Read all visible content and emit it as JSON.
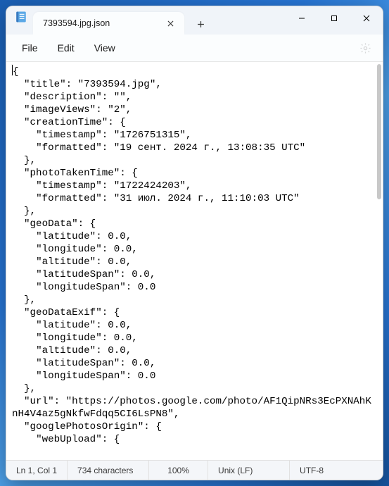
{
  "tab": {
    "title": "7393594.jpg.json"
  },
  "menu": {
    "file": "File",
    "edit": "Edit",
    "view": "View"
  },
  "editor": {
    "text": "{\n  \"title\": \"7393594.jpg\",\n  \"description\": \"\",\n  \"imageViews\": \"2\",\n  \"creationTime\": {\n    \"timestamp\": \"1726751315\",\n    \"formatted\": \"19 сент. 2024 г., 13:08:35 UTC\"\n  },\n  \"photoTakenTime\": {\n    \"timestamp\": \"1722424203\",\n    \"formatted\": \"31 июл. 2024 г., 11:10:03 UTC\"\n  },\n  \"geoData\": {\n    \"latitude\": 0.0,\n    \"longitude\": 0.0,\n    \"altitude\": 0.0,\n    \"latitudeSpan\": 0.0,\n    \"longitudeSpan\": 0.0\n  },\n  \"geoDataExif\": {\n    \"latitude\": 0.0,\n    \"longitude\": 0.0,\n    \"altitude\": 0.0,\n    \"latitudeSpan\": 0.0,\n    \"longitudeSpan\": 0.0\n  },\n  \"url\": \"https://photos.google.com/photo/AF1QipNRs3EcPXNAhKnH4V4az5gNkfwFdqq5CI6LsPN8\",\n  \"googlePhotosOrigin\": {\n    \"webUpload\": {"
  },
  "status": {
    "position": "Ln 1, Col 1",
    "characters": "734 characters",
    "zoom": "100%",
    "line_ending": "Unix (LF)",
    "encoding": "UTF-8"
  }
}
